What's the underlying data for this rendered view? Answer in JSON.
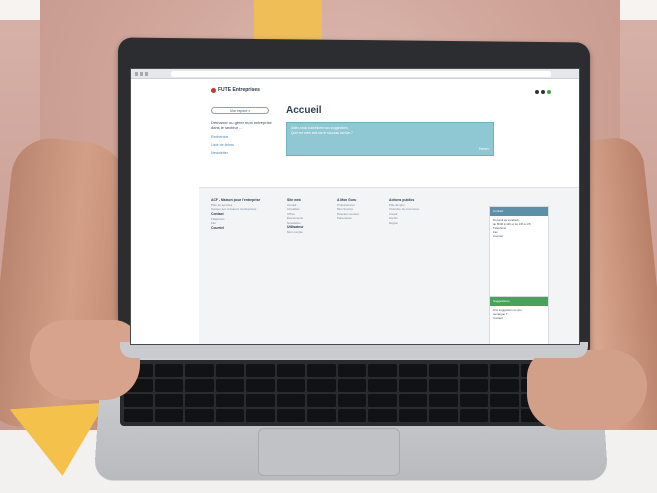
{
  "site": {
    "logo": "FUTE Entreprises",
    "header_controls": [
      "",
      "",
      ""
    ]
  },
  "sidebar": {
    "menu_button": "Mon espace ▾",
    "heading": "Démarrer ou gérer mon entreprise dans le secteur ...",
    "links": [
      "Recherche",
      "Liste de fiches",
      "Newsletter"
    ]
  },
  "main": {
    "title": "Accueil",
    "alert_line1": "Aidez-nous à améliorer nos suggestions.",
    "alert_line2": "Quel est votre avis sur le nouveau service ?",
    "alert_close": "Fermer"
  },
  "footer": {
    "col1": {
      "title": "ACF - Maison pour l'entreprise",
      "lines": [
        "Pôle de services",
        "Soutien aux créateurs d'entreprises",
        "Contact",
        "Téléphone",
        "Fax",
        "Courriel"
      ]
    },
    "col2": {
      "title": "Site web",
      "lines": [
        "Accueil",
        "Actualités",
        "Offres",
        "Événements",
        "Newsletter",
        "Utilisateur",
        "Mon compte"
      ]
    },
    "col3": {
      "title": "A Mon Guru",
      "lines": [
        "Professionnel",
        "Mon Service",
        "Réseaux sociaux",
        "Partenaires"
      ]
    },
    "col4": {
      "title": "Actions publics",
      "lines": [
        "Pôle Emploi",
        "Chambre de commerce",
        "Urssaf",
        "Impôts",
        "Région"
      ]
    },
    "panel_contact": {
      "header": "Contact",
      "lines": [
        "Du lundi au vendredi",
        "de 8h30 à 12h et de 13h à 17h",
        "Téléphone",
        "Fax",
        "Courriel"
      ]
    },
    "panel_suggest": {
      "header": "Suggestions",
      "lines": [
        "Une suggestion ou une",
        "remarque ?",
        "Contact"
      ]
    }
  },
  "colors": {
    "accent_yellow": "#f4c14a",
    "alert_teal": "#8fc7d2",
    "panel_blue": "#5c8fa9",
    "panel_green": "#49a25a"
  }
}
